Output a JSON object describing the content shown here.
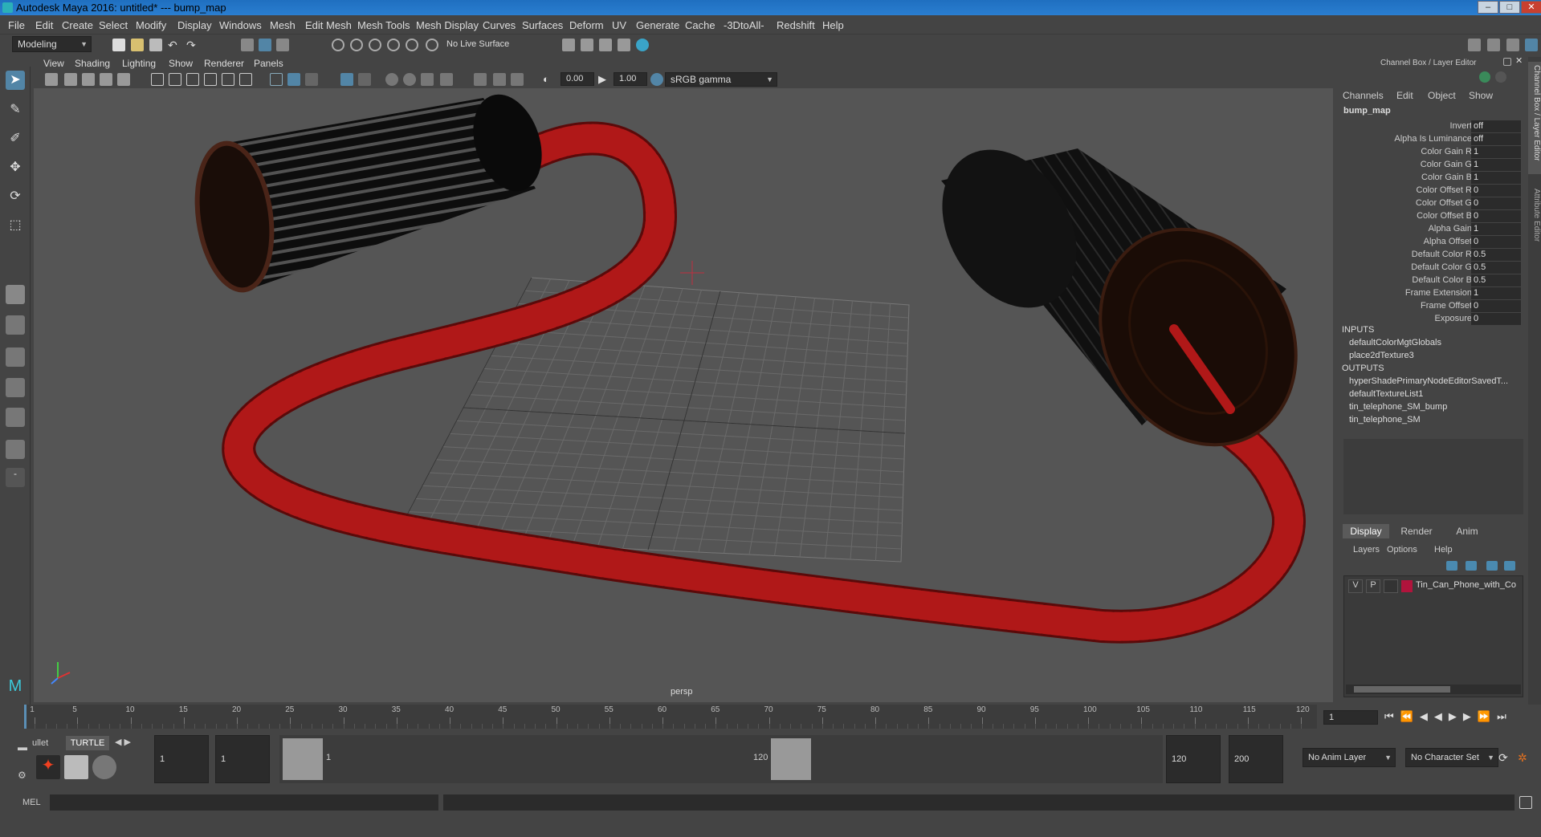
{
  "window": {
    "title": "Autodesk Maya 2016: untitled*   ---   bump_map",
    "minimize": "–",
    "maximize": "□",
    "close": "✕"
  },
  "menu": [
    "File",
    "Edit",
    "Create",
    "Select",
    "Modify",
    "Display",
    "Windows",
    "Mesh",
    "Edit Mesh",
    "Mesh Tools",
    "Mesh Display",
    "Curves",
    "Surfaces",
    "Deform",
    "UV",
    "Generate",
    "Cache",
    "-3DtoAll-",
    "Redshift",
    "Help"
  ],
  "shelf": {
    "mode": "Modeling",
    "live_surface": "No Live Surface"
  },
  "viewport_menu": [
    "View",
    "Shading",
    "Lighting",
    "Show",
    "Renderer",
    "Panels"
  ],
  "viewport_toolbar": {
    "exposure": "0.00",
    "gamma": "1.00",
    "color_space": "sRGB gamma"
  },
  "viewport": {
    "camera_label": "persp"
  },
  "channel_box": {
    "title": "Channel Box / Layer Editor",
    "menu": [
      "Channels",
      "Edit",
      "Object",
      "Show"
    ],
    "node": "bump_map",
    "attributes": [
      {
        "label": "Invert",
        "value": "off"
      },
      {
        "label": "Alpha Is Luminance",
        "value": "off"
      },
      {
        "label": "Color Gain R",
        "value": "1"
      },
      {
        "label": "Color Gain G",
        "value": "1"
      },
      {
        "label": "Color Gain B",
        "value": "1"
      },
      {
        "label": "Color Offset R",
        "value": "0"
      },
      {
        "label": "Color Offset G",
        "value": "0"
      },
      {
        "label": "Color Offset B",
        "value": "0"
      },
      {
        "label": "Alpha Gain",
        "value": "1"
      },
      {
        "label": "Alpha Offset",
        "value": "0"
      },
      {
        "label": "Default Color R",
        "value": "0.5"
      },
      {
        "label": "Default Color G",
        "value": "0.5"
      },
      {
        "label": "Default Color B",
        "value": "0.5"
      },
      {
        "label": "Frame Extension",
        "value": "1"
      },
      {
        "label": "Frame Offset",
        "value": "0"
      },
      {
        "label": "Exposure",
        "value": "0"
      }
    ],
    "inputs_label": "INPUTS",
    "inputs": [
      "defaultColorMgtGlobals",
      "place2dTexture3"
    ],
    "outputs_label": "OUTPUTS",
    "outputs": [
      "hyperShadePrimaryNodeEditorSavedT...",
      "defaultTextureList1",
      "tin_telephone_SM_bump",
      "tin_telephone_SM"
    ]
  },
  "layer_editor": {
    "tabs": [
      "Display",
      "Render",
      "Anim"
    ],
    "menu": [
      "Layers",
      "Options",
      "Help"
    ],
    "layer": {
      "v": "V",
      "p": "P",
      "name": "Tin_Can_Phone_with_Co",
      "color": "#b0143c"
    }
  },
  "side_tabs": [
    "Channel Box / Layer Editor",
    "Attribute Editor"
  ],
  "timeline": {
    "ticks": [
      "1",
      "5",
      "10",
      "15",
      "20",
      "25",
      "30",
      "35",
      "40",
      "45",
      "50",
      "55",
      "60",
      "65",
      "70",
      "75",
      "80",
      "85",
      "90",
      "95",
      "100",
      "105",
      "110",
      "115",
      "120"
    ],
    "current_frame": "1"
  },
  "range": {
    "shelf_tabs": [
      "ullet",
      "TURTLE"
    ],
    "start": "1",
    "inner_start": "1",
    "slider_start": "1",
    "slider_end": "120",
    "end": "120",
    "max_end": "200",
    "anim_layer": "No Anim Layer",
    "char_set": "No Character Set"
  },
  "command": {
    "label": "MEL"
  },
  "colors": {
    "accent": "#5285a6",
    "cord": "#b01818",
    "titlebar": "#2a7ed0"
  }
}
